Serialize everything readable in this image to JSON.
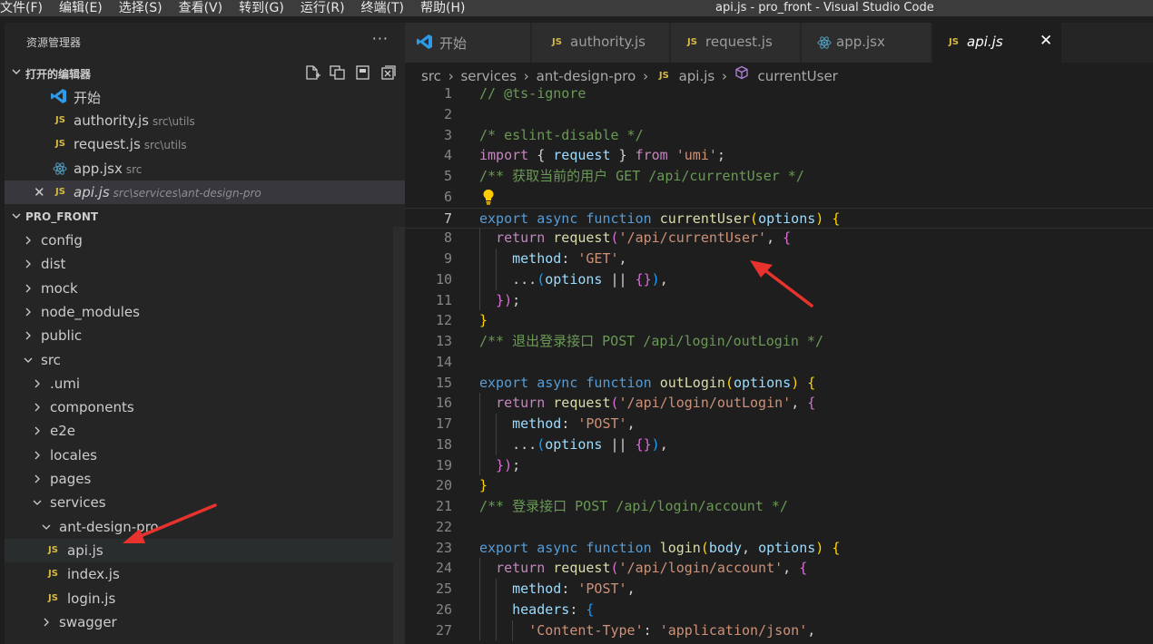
{
  "menu": [
    "文件(F)",
    "编辑(E)",
    "选择(S)",
    "查看(V)",
    "转到(G)",
    "运行(R)",
    "终端(T)",
    "帮助(H)"
  ],
  "window_title": "api.js - pro_front - Visual Studio Code",
  "explorer": {
    "title": "资源管理器",
    "more": "···",
    "open_editors": {
      "label": "打开的编辑器",
      "items": [
        {
          "name": "开始",
          "path": "",
          "badge": "vscode"
        },
        {
          "name": "authority.js",
          "path": "src\\utils",
          "badge": "JS"
        },
        {
          "name": "request.js",
          "path": "src\\utils",
          "badge": "JS"
        },
        {
          "name": "app.jsx",
          "path": "src",
          "badge": "react"
        },
        {
          "name": "api.js",
          "path": "src\\services\\ant-design-pro",
          "badge": "JS",
          "close": "✕"
        }
      ]
    },
    "project": {
      "label": "PRO_FRONT",
      "tree": [
        {
          "name": "config",
          "type": "folder",
          "level": 0
        },
        {
          "name": "dist",
          "type": "folder",
          "level": 0
        },
        {
          "name": "mock",
          "type": "folder",
          "level": 0
        },
        {
          "name": "node_modules",
          "type": "folder",
          "level": 0
        },
        {
          "name": "public",
          "type": "folder",
          "level": 0
        },
        {
          "name": "src",
          "type": "folder-open",
          "level": 0
        },
        {
          "name": ".umi",
          "type": "folder",
          "level": 1
        },
        {
          "name": "components",
          "type": "folder",
          "level": 1
        },
        {
          "name": "e2e",
          "type": "folder",
          "level": 1
        },
        {
          "name": "locales",
          "type": "folder",
          "level": 1
        },
        {
          "name": "pages",
          "type": "folder",
          "level": 1
        },
        {
          "name": "services",
          "type": "folder-open",
          "level": 1
        },
        {
          "name": "ant-design-pro",
          "type": "folder-open",
          "level": 2
        },
        {
          "name": "api.js",
          "type": "js",
          "level": 3
        },
        {
          "name": "index.js",
          "type": "js",
          "level": 3
        },
        {
          "name": "login.js",
          "type": "js",
          "level": 3
        },
        {
          "name": "swagger",
          "type": "folder",
          "level": 2
        }
      ]
    }
  },
  "tabs": [
    {
      "label": "开始",
      "badge": "vscode"
    },
    {
      "label": "authority.js",
      "badge": "JS"
    },
    {
      "label": "request.js",
      "badge": "JS"
    },
    {
      "label": "app.jsx",
      "badge": "react"
    },
    {
      "label": "api.js",
      "badge": "JS",
      "close": "✕"
    }
  ],
  "breadcrumb": [
    "src",
    "services",
    "ant-design-pro",
    "api.js",
    "currentUser"
  ],
  "code_lines": [
    [
      [
        "c",
        "// @ts-ignore"
      ]
    ],
    [],
    [
      [
        "c",
        "/* eslint-disable */"
      ]
    ],
    [
      [
        "k",
        "import"
      ],
      [
        "p",
        " { "
      ],
      [
        "v",
        "request"
      ],
      [
        "p",
        " } "
      ],
      [
        "k",
        "from"
      ],
      [
        "p",
        " "
      ],
      [
        "s",
        "'umi'"
      ],
      [
        "p",
        ";"
      ]
    ],
    [
      [
        "c",
        "/** 获取当前的用户 GET /api/currentUser */"
      ]
    ],
    [],
    [
      [
        "b",
        "export"
      ],
      [
        "p",
        " "
      ],
      [
        "b",
        "async"
      ],
      [
        "p",
        " "
      ],
      [
        "b",
        "function"
      ],
      [
        "p",
        " "
      ],
      [
        "f",
        "currentUser"
      ],
      [
        "y",
        "("
      ],
      [
        "v",
        "options"
      ],
      [
        "y",
        ")"
      ],
      [
        "p",
        " "
      ],
      [
        "y",
        "{"
      ]
    ],
    [
      [
        "p",
        "  "
      ],
      [
        "k",
        "return"
      ],
      [
        "p",
        " "
      ],
      [
        "f",
        "request"
      ],
      [
        "m",
        "("
      ],
      [
        "s",
        "'/api/currentUser'"
      ],
      [
        "p",
        ", "
      ],
      [
        "m",
        "{"
      ]
    ],
    [
      [
        "p",
        "    "
      ],
      [
        "v",
        "method"
      ],
      [
        "p",
        ": "
      ],
      [
        "s",
        "'GET'"
      ],
      [
        "p",
        ","
      ]
    ],
    [
      [
        "p",
        "    ..."
      ],
      [
        "bl",
        "("
      ],
      [
        "v",
        "options"
      ],
      [
        "p",
        " || "
      ],
      [
        "m",
        "{}"
      ],
      [
        "bl",
        ")"
      ],
      [
        "p",
        ","
      ]
    ],
    [
      [
        "p",
        "  "
      ],
      [
        "m",
        "}"
      ],
      [
        "m",
        ")"
      ],
      [
        "p",
        ";"
      ]
    ],
    [
      [
        "y",
        "}"
      ]
    ],
    [
      [
        "c",
        "/** 退出登录接口 POST /api/login/outLogin */"
      ]
    ],
    [],
    [
      [
        "b",
        "export"
      ],
      [
        "p",
        " "
      ],
      [
        "b",
        "async"
      ],
      [
        "p",
        " "
      ],
      [
        "b",
        "function"
      ],
      [
        "p",
        " "
      ],
      [
        "f",
        "outLogin"
      ],
      [
        "y",
        "("
      ],
      [
        "v",
        "options"
      ],
      [
        "y",
        ")"
      ],
      [
        "p",
        " "
      ],
      [
        "y",
        "{"
      ]
    ],
    [
      [
        "p",
        "  "
      ],
      [
        "k",
        "return"
      ],
      [
        "p",
        " "
      ],
      [
        "f",
        "request"
      ],
      [
        "m",
        "("
      ],
      [
        "s",
        "'/api/login/outLogin'"
      ],
      [
        "p",
        ", "
      ],
      [
        "m",
        "{"
      ]
    ],
    [
      [
        "p",
        "    "
      ],
      [
        "v",
        "method"
      ],
      [
        "p",
        ": "
      ],
      [
        "s",
        "'POST'"
      ],
      [
        "p",
        ","
      ]
    ],
    [
      [
        "p",
        "    ..."
      ],
      [
        "bl",
        "("
      ],
      [
        "v",
        "options"
      ],
      [
        "p",
        " || "
      ],
      [
        "m",
        "{}"
      ],
      [
        "bl",
        ")"
      ],
      [
        "p",
        ","
      ]
    ],
    [
      [
        "p",
        "  "
      ],
      [
        "m",
        "}"
      ],
      [
        "m",
        ")"
      ],
      [
        "p",
        ";"
      ]
    ],
    [
      [
        "y",
        "}"
      ]
    ],
    [
      [
        "c",
        "/** 登录接口 POST /api/login/account */"
      ]
    ],
    [],
    [
      [
        "b",
        "export"
      ],
      [
        "p",
        " "
      ],
      [
        "b",
        "async"
      ],
      [
        "p",
        " "
      ],
      [
        "b",
        "function"
      ],
      [
        "p",
        " "
      ],
      [
        "f",
        "login"
      ],
      [
        "y",
        "("
      ],
      [
        "v",
        "body"
      ],
      [
        "p",
        ", "
      ],
      [
        "v",
        "options"
      ],
      [
        "y",
        ")"
      ],
      [
        "p",
        " "
      ],
      [
        "y",
        "{"
      ]
    ],
    [
      [
        "p",
        "  "
      ],
      [
        "k",
        "return"
      ],
      [
        "p",
        " "
      ],
      [
        "f",
        "request"
      ],
      [
        "m",
        "("
      ],
      [
        "s",
        "'/api/login/account'"
      ],
      [
        "p",
        ", "
      ],
      [
        "m",
        "{"
      ]
    ],
    [
      [
        "p",
        "    "
      ],
      [
        "v",
        "method"
      ],
      [
        "p",
        ": "
      ],
      [
        "s",
        "'POST'"
      ],
      [
        "p",
        ","
      ]
    ],
    [
      [
        "p",
        "    "
      ],
      [
        "v",
        "headers"
      ],
      [
        "p",
        ": "
      ],
      [
        "bl",
        "{"
      ]
    ],
    [
      [
        "p",
        "      "
      ],
      [
        "s",
        "'Content-Type'"
      ],
      [
        "p",
        ": "
      ],
      [
        "s",
        "'application/json'"
      ],
      [
        "p",
        ","
      ]
    ]
  ],
  "active_line": 7,
  "colors": {
    "keyword": "#c586c0",
    "storage": "#569cd6",
    "function": "#dcdcaa",
    "variable": "#9cdcfe",
    "string": "#ce9178",
    "comment": "#6a9955",
    "bracket_yellow": "#ffd700",
    "bracket_magenta": "#da70d6",
    "bracket_blue": "#179fff",
    "plain": "#d4d4d4",
    "annotation_arrow": "#e8322d"
  }
}
